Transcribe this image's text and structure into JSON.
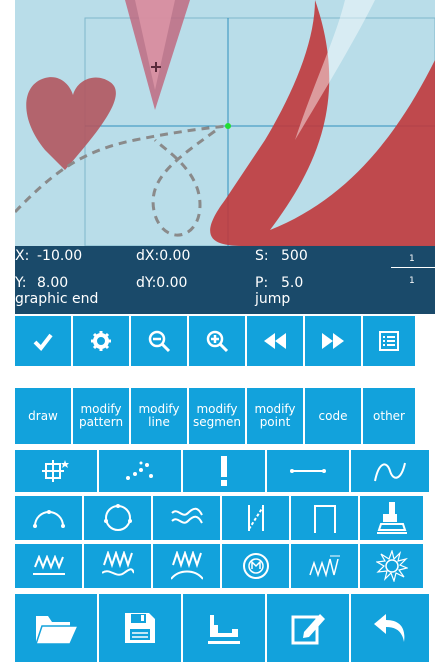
{
  "status": {
    "x_label": "X:",
    "x_value": "-10.00",
    "y_label": "Y:",
    "y_value": "8.00",
    "dx": "dX:0.00",
    "dy": "dY:0.00",
    "s_label": "S:",
    "s_value": "500",
    "p_label": "P:",
    "p_value": "5.0",
    "message_left": "graphic end",
    "message_right": "jump",
    "ratio_top": "1",
    "ratio_bottom": "1"
  },
  "toolbar1": {
    "confirm": "check-icon",
    "settings": "gear-icon",
    "zoom_out": "zoom-out-icon",
    "zoom_in": "zoom-in-icon",
    "rewind": "rewind-icon",
    "forward": "fast-forward-icon",
    "list": "list-icon"
  },
  "menu": {
    "draw": "draw",
    "modify_pattern_1": "modify",
    "modify_pattern_2": "pattern",
    "modify_line_1": "modify",
    "modify_line_2": "line",
    "modify_segment_1": "modify",
    "modify_segment_2": "segmen",
    "modify_point_1": "modify",
    "modify_point_2": "point",
    "code": "code",
    "other": "other"
  },
  "colors": {
    "button": "#12a2dc",
    "canvas": "#b9dde9",
    "status_bg": "#1a4a6a",
    "accent_red": "#c0393c"
  }
}
